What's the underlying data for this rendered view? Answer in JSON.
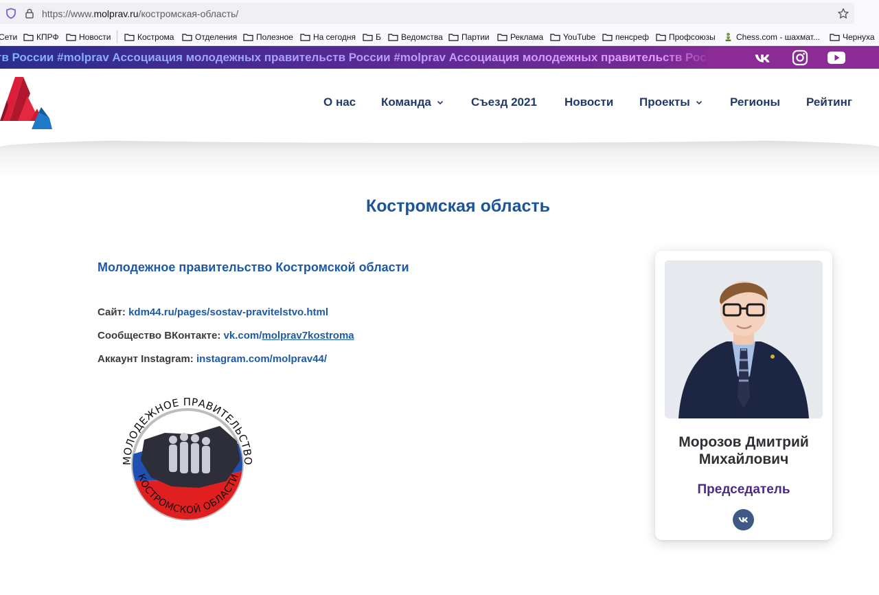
{
  "browser": {
    "url_prefix": "https://www.",
    "url_host": "molprav.ru",
    "url_path": "/костромская-область/",
    "bookmarks": [
      {
        "label": "Сети",
        "folder": false
      },
      {
        "label": "КПРФ",
        "folder": true
      },
      {
        "label": "Новости",
        "folder": true
      },
      {
        "label": "Кострома",
        "folder": true
      },
      {
        "label": "Отделения",
        "folder": true
      },
      {
        "label": "Полезное",
        "folder": true
      },
      {
        "label": "На сегодня",
        "folder": true
      },
      {
        "label": "Б",
        "folder": true
      },
      {
        "label": "Ведомства",
        "folder": true
      },
      {
        "label": "Партии",
        "folder": true
      },
      {
        "label": "Реклама",
        "folder": true
      },
      {
        "label": "YouTube",
        "folder": true
      },
      {
        "label": "пенсреф",
        "folder": true
      },
      {
        "label": "Профсоюзы",
        "folder": true
      },
      {
        "label": "Chess.com - шахмат...",
        "folder": false
      },
      {
        "label": "Чернуха",
        "folder": true
      }
    ]
  },
  "ticker": {
    "text": "тв России #molprav Ассоциация молодежных правительств России #molprav Ассоциация молодежных правительств Рос"
  },
  "nav": {
    "items": [
      {
        "label": "О нас",
        "dropdown": false
      },
      {
        "label": "Команда",
        "dropdown": true
      },
      {
        "label": "Съезд 2021",
        "dropdown": false
      },
      {
        "label": "Новости",
        "dropdown": false
      },
      {
        "label": "Проекты",
        "dropdown": true
      },
      {
        "label": "Регионы",
        "dropdown": false
      },
      {
        "label": "Рейтинг",
        "dropdown": false
      }
    ]
  },
  "content": {
    "page_title": "Костромская область",
    "org_title": "Молодежное правительство Костромской области",
    "site_label": "Сайт:",
    "site_link": "kdm44.ru/pages/sostav-pravitelstvo.html",
    "vk_label": "Сообщество ВКонтакте:",
    "vk_link_prefix": "vk.com/",
    "vk_link_path": "molprav7kostroma",
    "ig_label": "Аккаунт Instagram:",
    "ig_link": "instagram.com/molprav44/",
    "emblem_top_text": "МОЛОДЕЖНОЕ ПРАВИТЕЛЬСТВО",
    "emblem_bottom_text": "КОСТРОМСКОЙ ОБЛАСТИ"
  },
  "card": {
    "name_line1": "Морозов Дмитрий",
    "name_line2": "Михайлович",
    "role": "Председатель"
  },
  "colors": {
    "title_blue": "#1a5599",
    "nav_dark": "#1d3a6b",
    "role_purple": "#4b2c82",
    "ticker_start": "#2a2d8f",
    "ticker_end": "#8b2b96"
  }
}
